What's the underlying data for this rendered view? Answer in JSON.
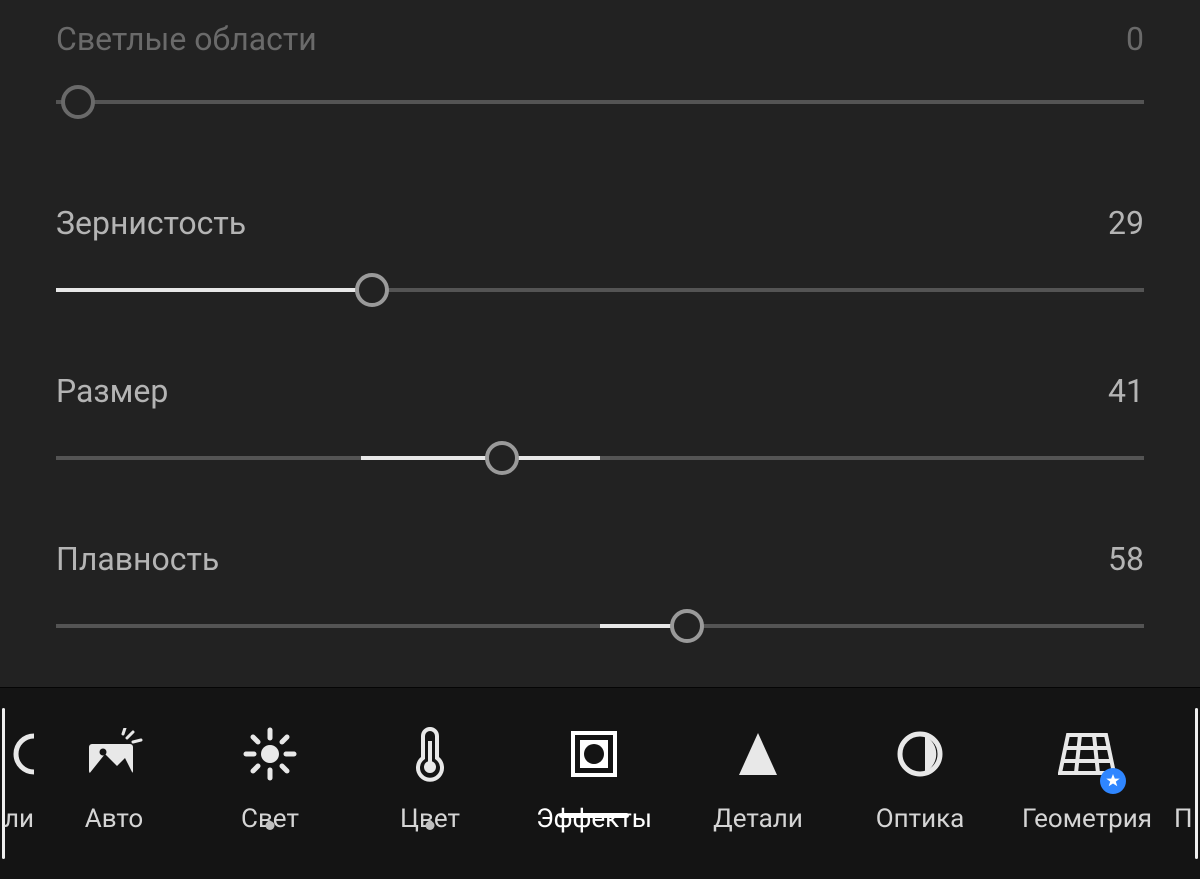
{
  "sliders": {
    "highlights": {
      "label": "Светлые области",
      "value": 0,
      "percent": 2,
      "active": false
    },
    "grain": {
      "label": "Зернистость",
      "value": 29,
      "percent": 29,
      "active": true
    },
    "size": {
      "label": "Размер",
      "value": 41,
      "percent": 41,
      "active": true
    },
    "roughness": {
      "label": "Плавность",
      "value": 58,
      "percent": 58,
      "active": true
    }
  },
  "toolbar": {
    "partial_left_label": "ли",
    "partial_right_label": "П",
    "items": {
      "auto": {
        "label": "Авто",
        "active": false,
        "dot": false
      },
      "light": {
        "label": "Свет",
        "active": false,
        "dot": true
      },
      "color": {
        "label": "Цвет",
        "active": false,
        "dot": true
      },
      "effects": {
        "label": "Эффекты",
        "active": true,
        "dot": false
      },
      "details": {
        "label": "Детали",
        "active": false,
        "dot": false
      },
      "optics": {
        "label": "Оптика",
        "active": false,
        "dot": false
      },
      "geometry": {
        "label": "Геометрия",
        "active": false,
        "dot": false,
        "badge": true
      }
    }
  }
}
